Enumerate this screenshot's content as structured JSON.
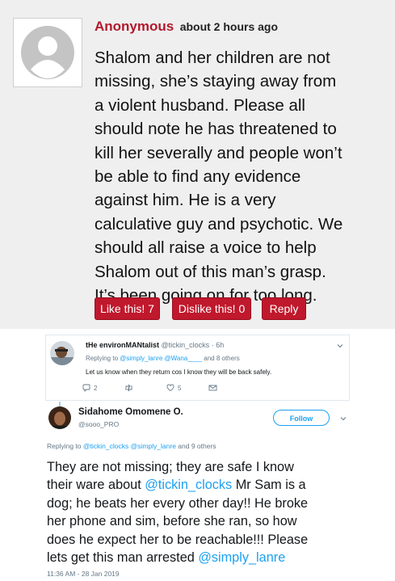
{
  "comment": {
    "author": "Anonymous",
    "time": "about 2 hours ago",
    "body_lines": [
      "Shalom and her children are not",
      "missing, she’s staying away from",
      "a violent husband. Please all",
      "should note he has threatened to",
      "kill her severally and people won’t",
      "be able to find any evidence",
      "against him. He is a very",
      "calculative guy and psychotic. We",
      "should all raise a voice to help",
      "Shalom out of this man’s grasp.",
      "It’s been going on for too long."
    ],
    "buttons": {
      "like": "Like this! 7",
      "dislike": "Dislike this! 0",
      "reply": "Reply"
    }
  },
  "tweet1": {
    "name": "tHe environMANtalist",
    "handle": "@tickin_clocks",
    "time": "· 6h",
    "replying_prefix": "Replying to ",
    "replying_handles": "@simply_lanre @Wana____",
    "replying_suffix": " and 8 others",
    "text": "Let us know  when they return cos I know they will be back safely.",
    "reply_count": "2",
    "like_count": "5"
  },
  "tweet2": {
    "name": "Sidahome Omomene O.",
    "handle": "@sooo_PRO",
    "follow_label": "Follow",
    "replying_prefix": "Replying to ",
    "replying_handles": "@tickin_clocks @simply_lanre",
    "replying_suffix": " and 9 others",
    "body": {
      "l1": "They are not missing; they are safe I know",
      "l2_pre": "their ware about ",
      "l2_mention": "@tickin_clocks",
      "l2_post": " Mr Sam is a",
      "l3": "dog; he beats her every other day!! He broke",
      "l4": "her phone and sim, before she ran, so how",
      "l5": "does he expect her to be reachable!!! Please",
      "l6_pre": "lets get this man arrested ",
      "l6_mention": "@simply_lanre"
    },
    "timestamp": "11:36 AM - 28 Jan 2019"
  },
  "colors": {
    "brand_red": "#c0182c",
    "twitter_blue": "#1da1f2",
    "muted_gray": "#657786"
  }
}
